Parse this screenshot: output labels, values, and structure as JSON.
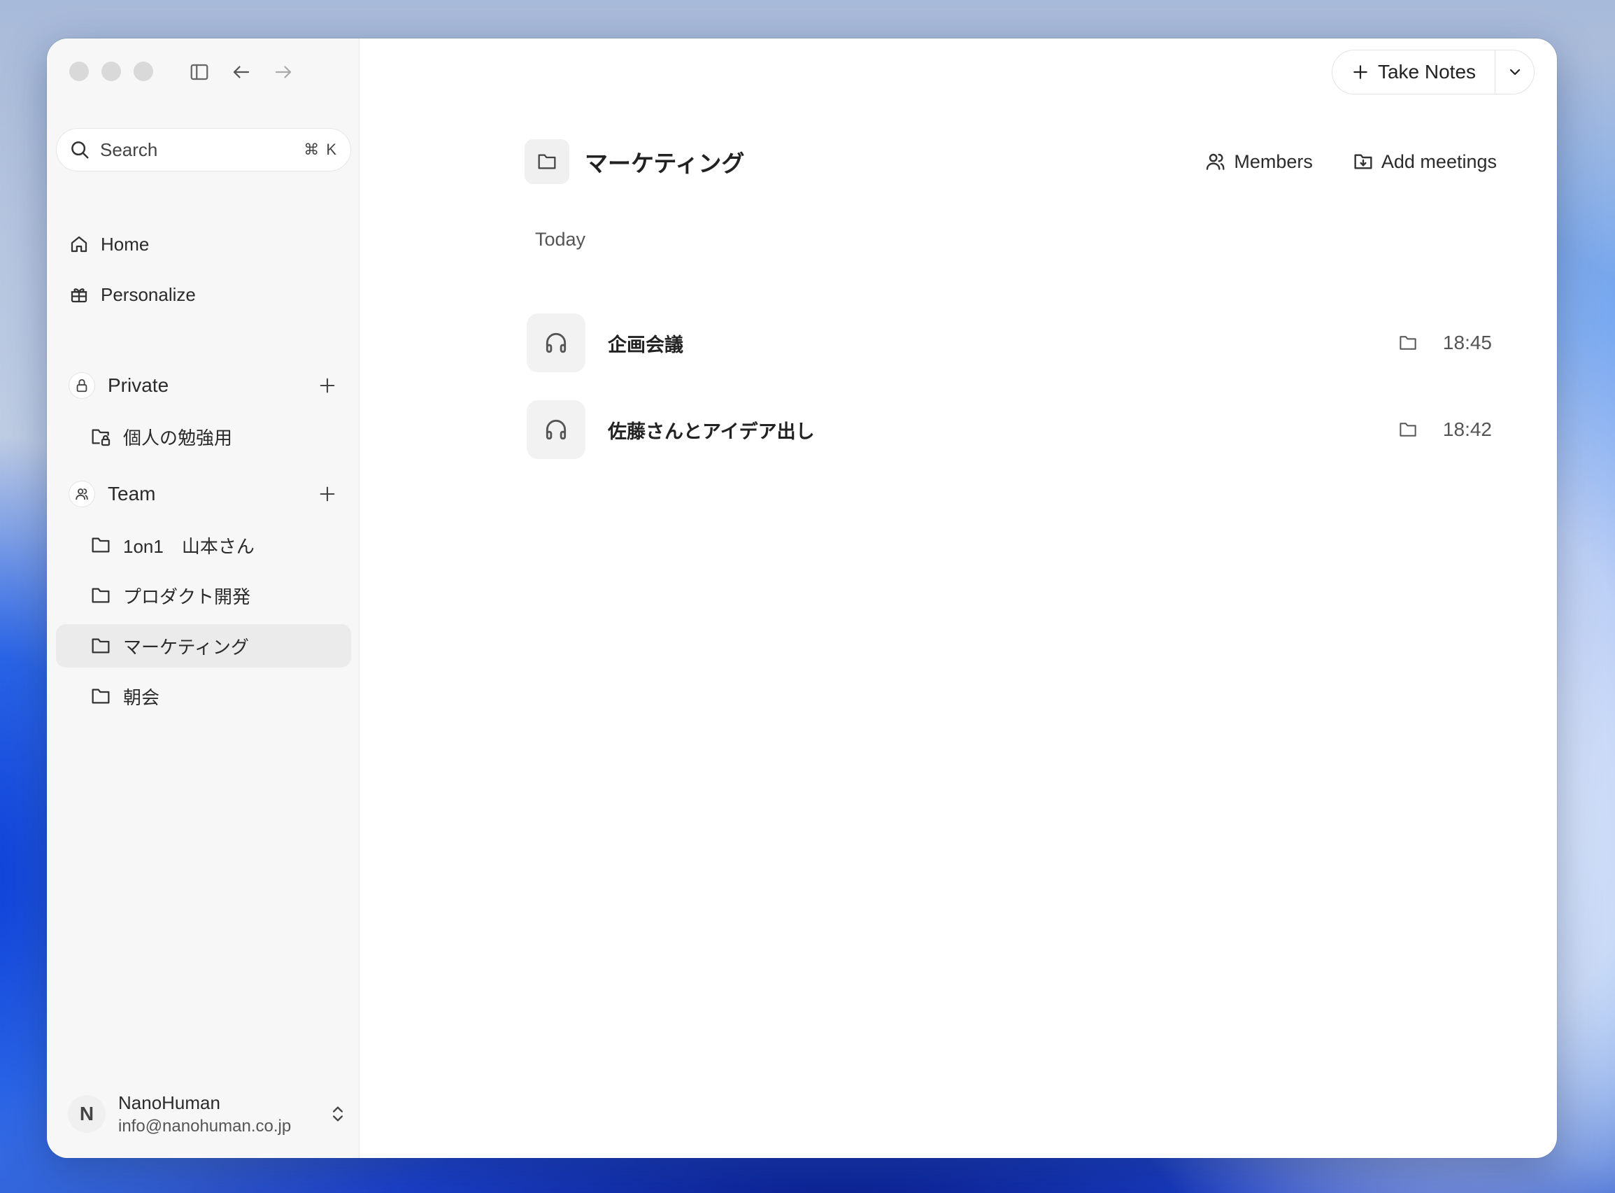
{
  "sidebar": {
    "search": {
      "label": "Search",
      "shortcut": "⌘ K"
    },
    "nav": [
      {
        "label": "Home",
        "icon": "home-icon"
      },
      {
        "label": "Personalize",
        "icon": "gift-icon"
      }
    ],
    "private": {
      "label": "Private",
      "items": [
        {
          "label": "個人の勉強用",
          "icon": "lock-folder-icon"
        }
      ]
    },
    "team": {
      "label": "Team",
      "items": [
        {
          "label": "1on1　山本さん"
        },
        {
          "label": "プロダクト開発"
        },
        {
          "label": "マーケティング",
          "active": true
        },
        {
          "label": "朝会"
        }
      ]
    },
    "user": {
      "initial": "N",
      "name": "NanoHuman",
      "email": "info@nanohuman.co.jp"
    }
  },
  "toolbar": {
    "take_notes_label": "Take Notes"
  },
  "page": {
    "title": "マーケティング",
    "members_label": "Members",
    "add_meetings_label": "Add meetings",
    "group_label": "Today",
    "meetings": [
      {
        "title": "企画会議",
        "time": "18:45"
      },
      {
        "title": "佐藤さんとアイデア出し",
        "time": "18:42"
      }
    ]
  },
  "colors": {
    "active_bg": "#ebebeb",
    "sidebar_bg": "#f7f7f7",
    "icon_bg": "#f2f2f2"
  }
}
